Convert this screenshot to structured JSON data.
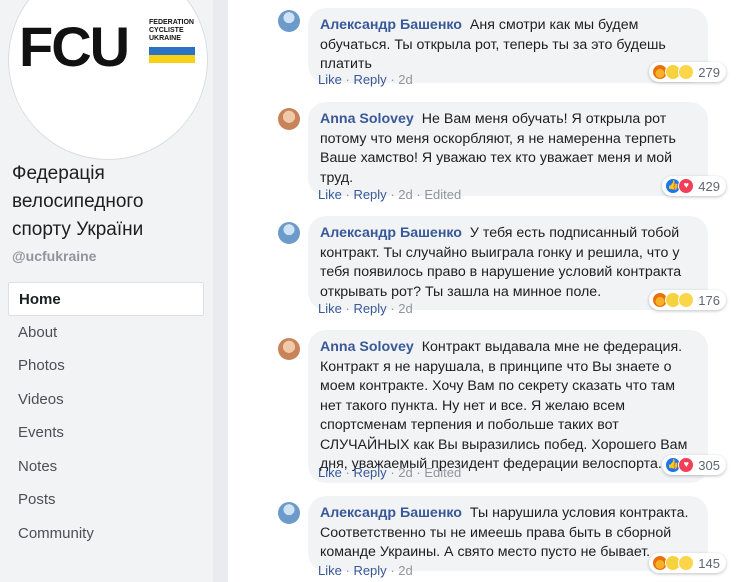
{
  "page": {
    "logo_text": "FCU",
    "logo_subtext": "FEDERATION\nCYCLISTE\nUKRAINE",
    "name": "Федерація велосипедного спорту України",
    "handle": "@ucfukraine"
  },
  "nav": [
    "Home",
    "About",
    "Photos",
    "Videos",
    "Events",
    "Notes",
    "Posts",
    "Community"
  ],
  "comments": [
    {
      "author": "Александр Башенко",
      "text": "Аня смотри как мы будем обучаться. Ты открыла рот, теперь ты за это будешь платить",
      "like": "Like",
      "reply": "Reply",
      "time": "2d",
      "edited": "",
      "reactions": [
        "angry",
        "haha",
        "wow"
      ],
      "count": "279"
    },
    {
      "author": "Anna Solovey",
      "text": "Не Вам меня обучать! Я открыла рот потому что меня оскорбляют, я не намеренна терпеть Ваше хамство! Я уважаю тех кто уважает меня и мой труд.",
      "like": "Like",
      "reply": "Reply",
      "time": "2d",
      "edited": "Edited",
      "reactions": [
        "like",
        "love"
      ],
      "count": "429"
    },
    {
      "author": "Александр Башенко",
      "text": "У тебя есть подписанный тобой контракт. Ты случайно выиграла гонку и решила, что у тебя появилось право в нарушение условий контракта открывать рот? Ты зашла на минное поле.",
      "like": "Like",
      "reply": "Reply",
      "time": "2d",
      "edited": "",
      "reactions": [
        "angry",
        "haha",
        "wow"
      ],
      "count": "176"
    },
    {
      "author": "Anna Solovey",
      "text": "Контракт выдавала мне не федерация. Контракт я не нарушала, в принципе что Вы знаете о моем контракте. Хочу Вам по секрету сказать что там нет такого пункта. Ну нет и все. Я желаю всем спортсменам терпения и побольше таких вот СЛУЧАЙНЫХ как Вы выразились побед. Хорошего Вам дня, уважаемый президент федерации велоспорта.",
      "like": "Like",
      "reply": "Reply",
      "time": "2d",
      "edited": "Edited",
      "reactions": [
        "like",
        "love"
      ],
      "count": "305"
    },
    {
      "author": "Александр Башенко",
      "text": "Ты нарушила условия контракта. Соответственно ты не имеешь права быть в сборной команде Украины. А свято место пусто не бывает.",
      "like": "Like",
      "reply": "Reply",
      "time": "2d",
      "edited": "",
      "reactions": [
        "angry",
        "haha",
        "wow"
      ],
      "count": "145"
    }
  ]
}
